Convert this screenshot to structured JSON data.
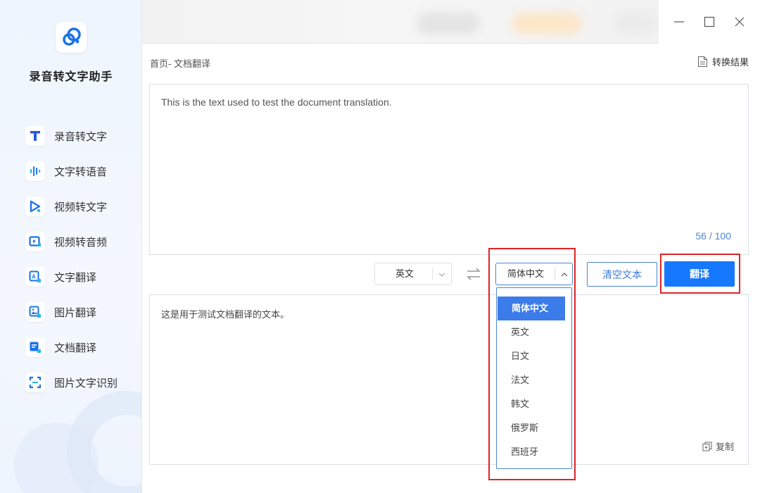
{
  "app": {
    "title": "录音转文字助手"
  },
  "nav": [
    {
      "label": "录音转文字",
      "icon": "text-t-icon"
    },
    {
      "label": "文字转语音",
      "icon": "soundwave-icon"
    },
    {
      "label": "视频转文字",
      "icon": "video-play-icon"
    },
    {
      "label": "视频转音频",
      "icon": "video-audio-icon"
    },
    {
      "label": "文字翻译",
      "icon": "text-translate-icon"
    },
    {
      "label": "图片翻译",
      "icon": "image-translate-icon"
    },
    {
      "label": "文档翻译",
      "icon": "document-translate-icon"
    },
    {
      "label": "图片文字识别",
      "icon": "scan-ocr-icon"
    }
  ],
  "breadcrumb": "首页- 文档翻译",
  "result_link": "转换结果",
  "source": {
    "text": "This is the text used to test the document translation.",
    "counter": "56 / 100"
  },
  "toolbar": {
    "source_lang": "英文",
    "target_lang": "简体中文",
    "clear_label": "清空文本",
    "translate_label": "翻译"
  },
  "dropdown": {
    "options": [
      "简体中文",
      "英文",
      "日文",
      "法文",
      "韩文",
      "俄罗斯",
      "西班牙"
    ],
    "selected": "简体中文"
  },
  "target": {
    "text": "这是用于测试文档翻译的文本。",
    "copy_label": "复制"
  },
  "colors": {
    "primary": "#1677ff",
    "accent_border": "#4a87d6",
    "annotation_red": "#e02424"
  }
}
